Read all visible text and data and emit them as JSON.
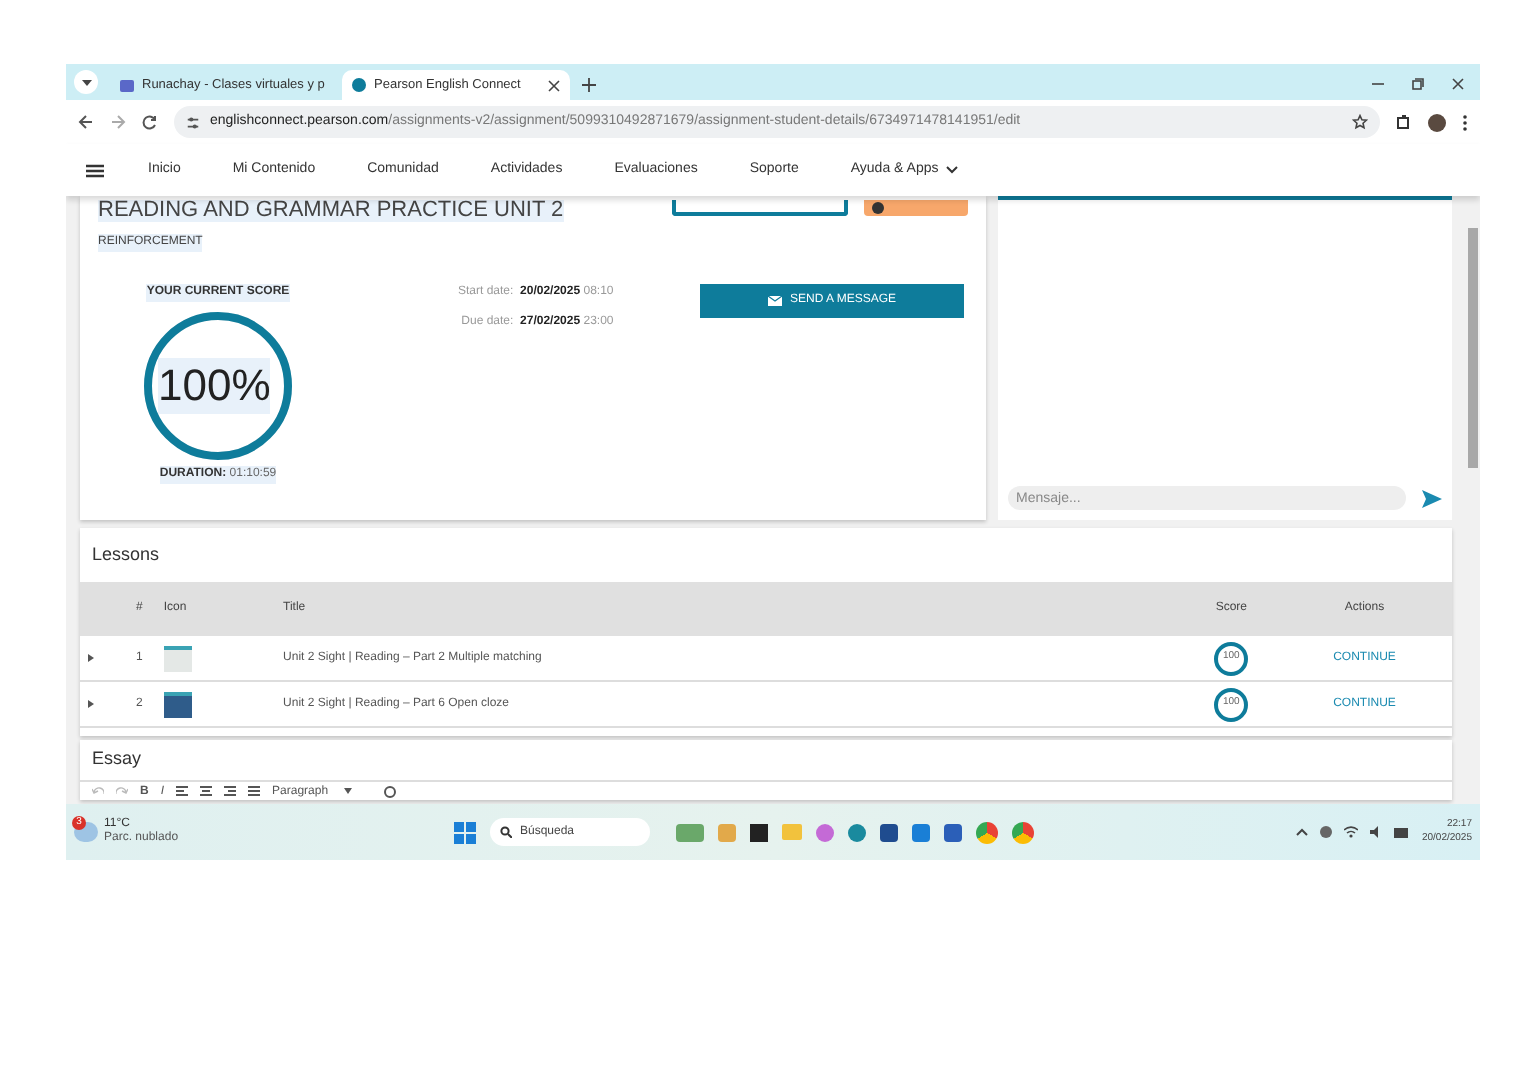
{
  "browser": {
    "tabs": [
      {
        "title": "Runachay - Clases virtuales y p",
        "selected": false
      },
      {
        "title": "Pearson English Connect",
        "selected": true
      }
    ],
    "url_host": "englishconnect.pearson.com",
    "url_path": "/assignments-v2/assignment/5099310492871679/assignment-student-details/6734971478141951/edit"
  },
  "nav": {
    "items": [
      {
        "label": "Inicio"
      },
      {
        "label": "Mi Contenido"
      },
      {
        "label": "Comunidad"
      },
      {
        "label": "Actividades"
      },
      {
        "label": "Evaluaciones"
      },
      {
        "label": "Soporte"
      },
      {
        "label": "Ayuda & Apps",
        "dropdown": true
      }
    ]
  },
  "assignment": {
    "title": "READING AND GRAMMAR PRACTICE UNIT 2",
    "category": "REINFORCEMENT",
    "score_label": "YOUR CURRENT SCORE",
    "score": "100%",
    "level": 1,
    "duration_label": "DURATION:",
    "duration": "01:10:59",
    "start_label": "Start date:",
    "start_date": "20/02/2025",
    "start_time": "08:10",
    "due_label": "Due date:",
    "due_date": "27/02/2025",
    "due_time": "23:00",
    "message_button": "SEND A MESSAGE"
  },
  "chat": {
    "placeholder": "Mensaje..."
  },
  "lessons": {
    "title": "Lessons",
    "columns": [
      "#",
      "Icon",
      "Title",
      "Score",
      "Actions"
    ],
    "rows": [
      {
        "number": "1",
        "title": "Unit 2 Sight | Reading – Part 2 Multiple matching",
        "score": "100",
        "action": "CONTINUE"
      },
      {
        "number": "2",
        "title": "Unit 2 Sight | Reading – Part 6 Open cloze",
        "score": "100",
        "action": "CONTINUE"
      }
    ]
  },
  "essay": {
    "title": "Essay",
    "bold_label": "B",
    "italic_label": "I",
    "format": "Paragraph"
  },
  "taskbar": {
    "temperature": "11°C",
    "weather": "Parc. nublado",
    "notification_count": "3",
    "search_placeholder": "Búsqueda",
    "time": "22:17",
    "date": "20/02/2025"
  }
}
